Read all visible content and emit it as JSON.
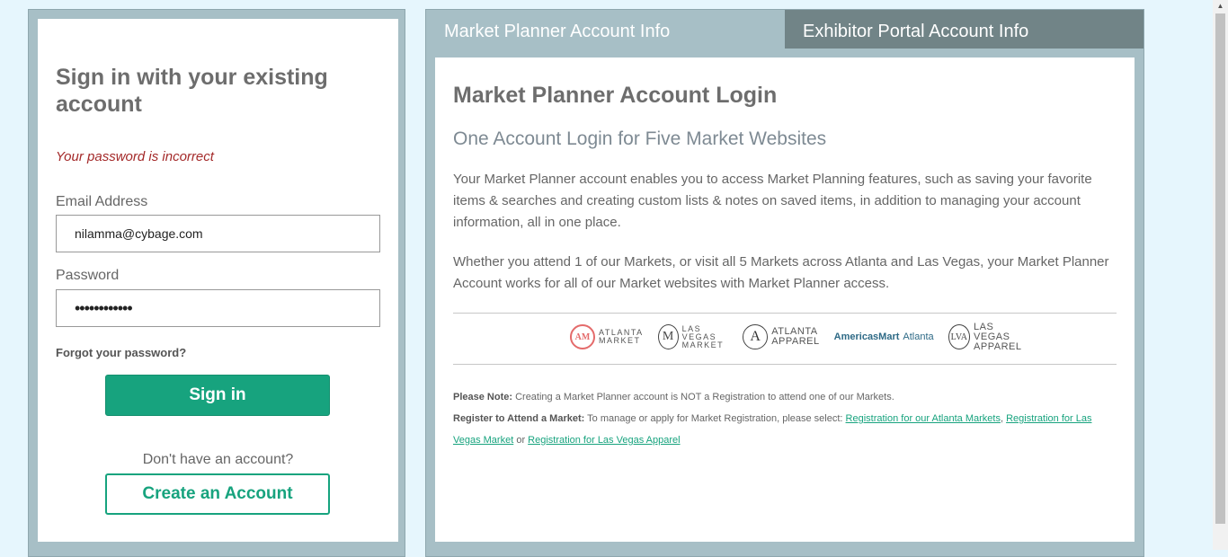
{
  "signin": {
    "title": "Sign in with your existing account",
    "error": "Your password is incorrect",
    "email_label": "Email Address",
    "email_value": "nilamma@cybage.com",
    "password_label": "Password",
    "password_value": "••••••••••••",
    "forgot": "Forgot your password?",
    "signin_button": "Sign in",
    "no_account": "Don't have an account?",
    "create_button": "Create an Account"
  },
  "tabs": {
    "market": "Market Planner Account Info",
    "exhibitor": "Exhibitor Portal Account Info",
    "active": "market"
  },
  "info": {
    "title": "Market Planner Account Login",
    "subtitle": "One Account Login for Five Market Websites",
    "para1": "Your Market Planner account enables you to access Market Planning features, such as saving your favorite items & searches and creating custom lists & notes on saved items, in addition to managing your account information, all in one place.",
    "para2": "Whether you attend 1 of our Markets, or visit all 5 Markets across Atlanta and Las Vegas, your Market Planner Account works for all of our Market websites with Market Planner access."
  },
  "logos": {
    "atlanta_market": {
      "mark": "AM",
      "text": "ATLANTA\nMARKET",
      "icon": "atlanta-market-logo"
    },
    "las_vegas_market": {
      "mark": "M",
      "text": "LAS VEGAS\nMARKET",
      "icon": "las-vegas-market-logo"
    },
    "atlanta_apparel": {
      "mark": "A",
      "text": "ATLANTA\nAPPAREL",
      "icon": "atlanta-apparel-logo"
    },
    "americasmart": {
      "name": "AmericasMart",
      "sub": "Atlanta",
      "icon": "americasmart-logo"
    },
    "las_vegas_apparel": {
      "mark": "LVA",
      "text": "LAS VEGAS\nAPPAREL",
      "icon": "las-vegas-apparel-logo"
    }
  },
  "notes": {
    "note_label": "Please Note:",
    "note_text": " Creating a Market Planner account is NOT a Registration to attend one of our Markets.",
    "register_label": "Register to Attend a Market:",
    "register_text": " To manage or apply for Market Registration, please select: ",
    "link_atlanta": "Registration for our Atlanta Markets",
    "sep1": ", ",
    "link_lv_market": "Registration for Las Vegas Market",
    "sep2": " or ",
    "link_lv_apparel": "Registration for Las Vegas Apparel"
  },
  "colors": {
    "accent": "#17a37e",
    "error": "#a42a2a",
    "panel_frame": "#a7bfc6",
    "tab_inactive": "#718487",
    "page_bg": "#e6f6fd"
  }
}
